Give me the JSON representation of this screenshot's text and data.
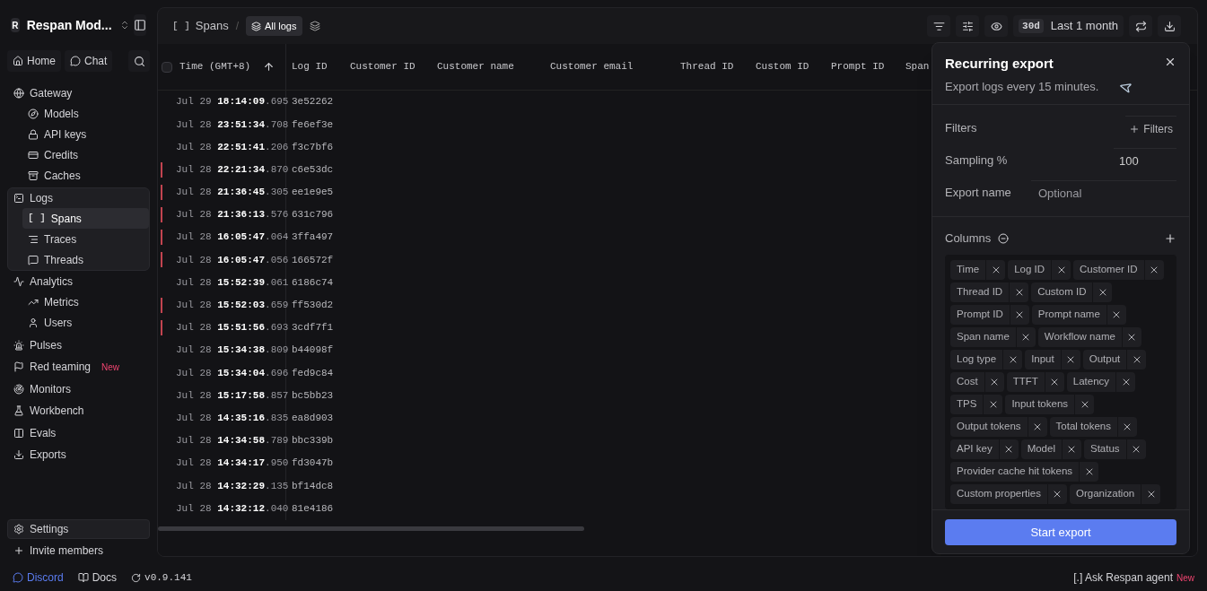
{
  "sidebar": {
    "workspace": {
      "initial": "R",
      "name": "Respan Mod..."
    },
    "nav_buttons": [
      "Home",
      "Chat"
    ],
    "sections": [
      {
        "label": "Gateway",
        "selected": false,
        "children": [
          {
            "label": "Models",
            "selected": false
          },
          {
            "label": "API keys",
            "selected": false
          },
          {
            "label": "Credits",
            "selected": false
          },
          {
            "label": "Caches",
            "selected": false
          }
        ]
      },
      {
        "label": "Logs",
        "selected": true,
        "children": [
          {
            "label": "Spans",
            "selected": true,
            "icon_text": "[ ]"
          },
          {
            "label": "Traces",
            "selected": false
          },
          {
            "label": "Threads",
            "selected": false
          }
        ]
      },
      {
        "label": "Analytics",
        "selected": false,
        "children": [
          {
            "label": "Metrics",
            "selected": false
          },
          {
            "label": "Users",
            "selected": false
          }
        ]
      },
      {
        "label": "Pulses",
        "selected": false
      },
      {
        "label": "Red teaming",
        "selected": false,
        "badge": "New"
      },
      {
        "label": "Monitors",
        "selected": false
      },
      {
        "label": "Workbench",
        "selected": false
      },
      {
        "label": "Evals",
        "selected": false
      },
      {
        "label": "Exports",
        "selected": false
      }
    ],
    "footer": [
      {
        "label": "Settings",
        "selected": true
      },
      {
        "label": "Invite members",
        "selected": false
      }
    ]
  },
  "toolbar": {
    "breadcrumb_icon": "[ ]",
    "breadcrumb": "Spans",
    "separator": "/",
    "tabs": [
      {
        "label": "All logs",
        "selected": true
      }
    ],
    "range_badge": "30d",
    "range": "Last 1 month"
  },
  "table": {
    "select_all": {
      "checked": false
    },
    "columns": [
      "Time (GMT+8)",
      "Log ID",
      "Customer ID",
      "Customer name",
      "Customer email",
      "Thread ID",
      "Custom ID",
      "Prompt ID",
      "Span"
    ],
    "rows": [
      {
        "date": "Jul 29",
        "time": "18:14:09",
        "ms": ".695",
        "log_id": "3e52262",
        "error": false
      },
      {
        "date": "Jul 28",
        "time": "23:51:34",
        "ms": ".708",
        "log_id": "fe6ef3e",
        "error": false
      },
      {
        "date": "Jul 28",
        "time": "22:51:41",
        "ms": ".206",
        "log_id": "f3c7bf6",
        "error": false
      },
      {
        "date": "Jul 28",
        "time": "22:21:34",
        "ms": ".870",
        "log_id": "c6e53dc",
        "error": true
      },
      {
        "date": "Jul 28",
        "time": "21:36:45",
        "ms": ".305",
        "log_id": "ee1e9e5",
        "error": true
      },
      {
        "date": "Jul 28",
        "time": "21:36:13",
        "ms": ".576",
        "log_id": "631c796",
        "error": true
      },
      {
        "date": "Jul 28",
        "time": "16:05:47",
        "ms": ".064",
        "log_id": "3ffa497",
        "error": true
      },
      {
        "date": "Jul 28",
        "time": "16:05:47",
        "ms": ".056",
        "log_id": "166572f",
        "error": true
      },
      {
        "date": "Jul 28",
        "time": "15:52:39",
        "ms": ".061",
        "log_id": "6186c74",
        "error": false
      },
      {
        "date": "Jul 28",
        "time": "15:52:03",
        "ms": ".659",
        "log_id": "ff530d2",
        "error": true
      },
      {
        "date": "Jul 28",
        "time": "15:51:56",
        "ms": ".693",
        "log_id": "3cdf7f1",
        "error": true
      },
      {
        "date": "Jul 28",
        "time": "15:34:38",
        "ms": ".809",
        "log_id": "b44098f",
        "error": false
      },
      {
        "date": "Jul 28",
        "time": "15:34:04",
        "ms": ".696",
        "log_id": "fed9c84",
        "error": false
      },
      {
        "date": "Jul 28",
        "time": "15:17:58",
        "ms": ".857",
        "log_id": "bc5bb23",
        "error": false
      },
      {
        "date": "Jul 28",
        "time": "14:35:16",
        "ms": ".835",
        "log_id": "ea8d903",
        "error": false
      },
      {
        "date": "Jul 28",
        "time": "14:34:58",
        "ms": ".789",
        "log_id": "bbc339b",
        "error": false
      },
      {
        "date": "Jul 28",
        "time": "14:34:17",
        "ms": ".950",
        "log_id": "fd3047b",
        "error": false
      },
      {
        "date": "Jul 28",
        "time": "14:32:29",
        "ms": ".135",
        "log_id": "bf14dc8",
        "error": false
      },
      {
        "date": "Jul 28",
        "time": "14:32:12",
        "ms": ".040",
        "log_id": "81e4186",
        "error": false
      }
    ]
  },
  "export_panel": {
    "title": "Recurring export",
    "subtitle": "Export logs every 15 minutes.",
    "filters": {
      "label": "Filters",
      "button": "Filters"
    },
    "sampling": {
      "label": "Sampling %",
      "value": "100"
    },
    "export_name": {
      "label": "Export name",
      "placeholder": "Optional"
    },
    "columns_label": "Columns",
    "columns": [
      "Time",
      "Log ID",
      "Customer ID",
      "Thread ID",
      "Custom ID",
      "Prompt ID",
      "Prompt name",
      "Span name",
      "Workflow name",
      "Log type",
      "Input",
      "Output",
      "Cost",
      "TTFT",
      "Latency",
      "TPS",
      "Input tokens",
      "Output tokens",
      "Total tokens",
      "API key",
      "Model",
      "Status",
      "Provider cache hit tokens",
      "Custom properties",
      "Organization"
    ],
    "submit": "Start export"
  },
  "bottom_bar": {
    "links": [
      "Discord",
      "Docs"
    ],
    "version": "v0.9.141",
    "agent": "[.] Ask Respan agent",
    "agent_badge": "New"
  }
}
